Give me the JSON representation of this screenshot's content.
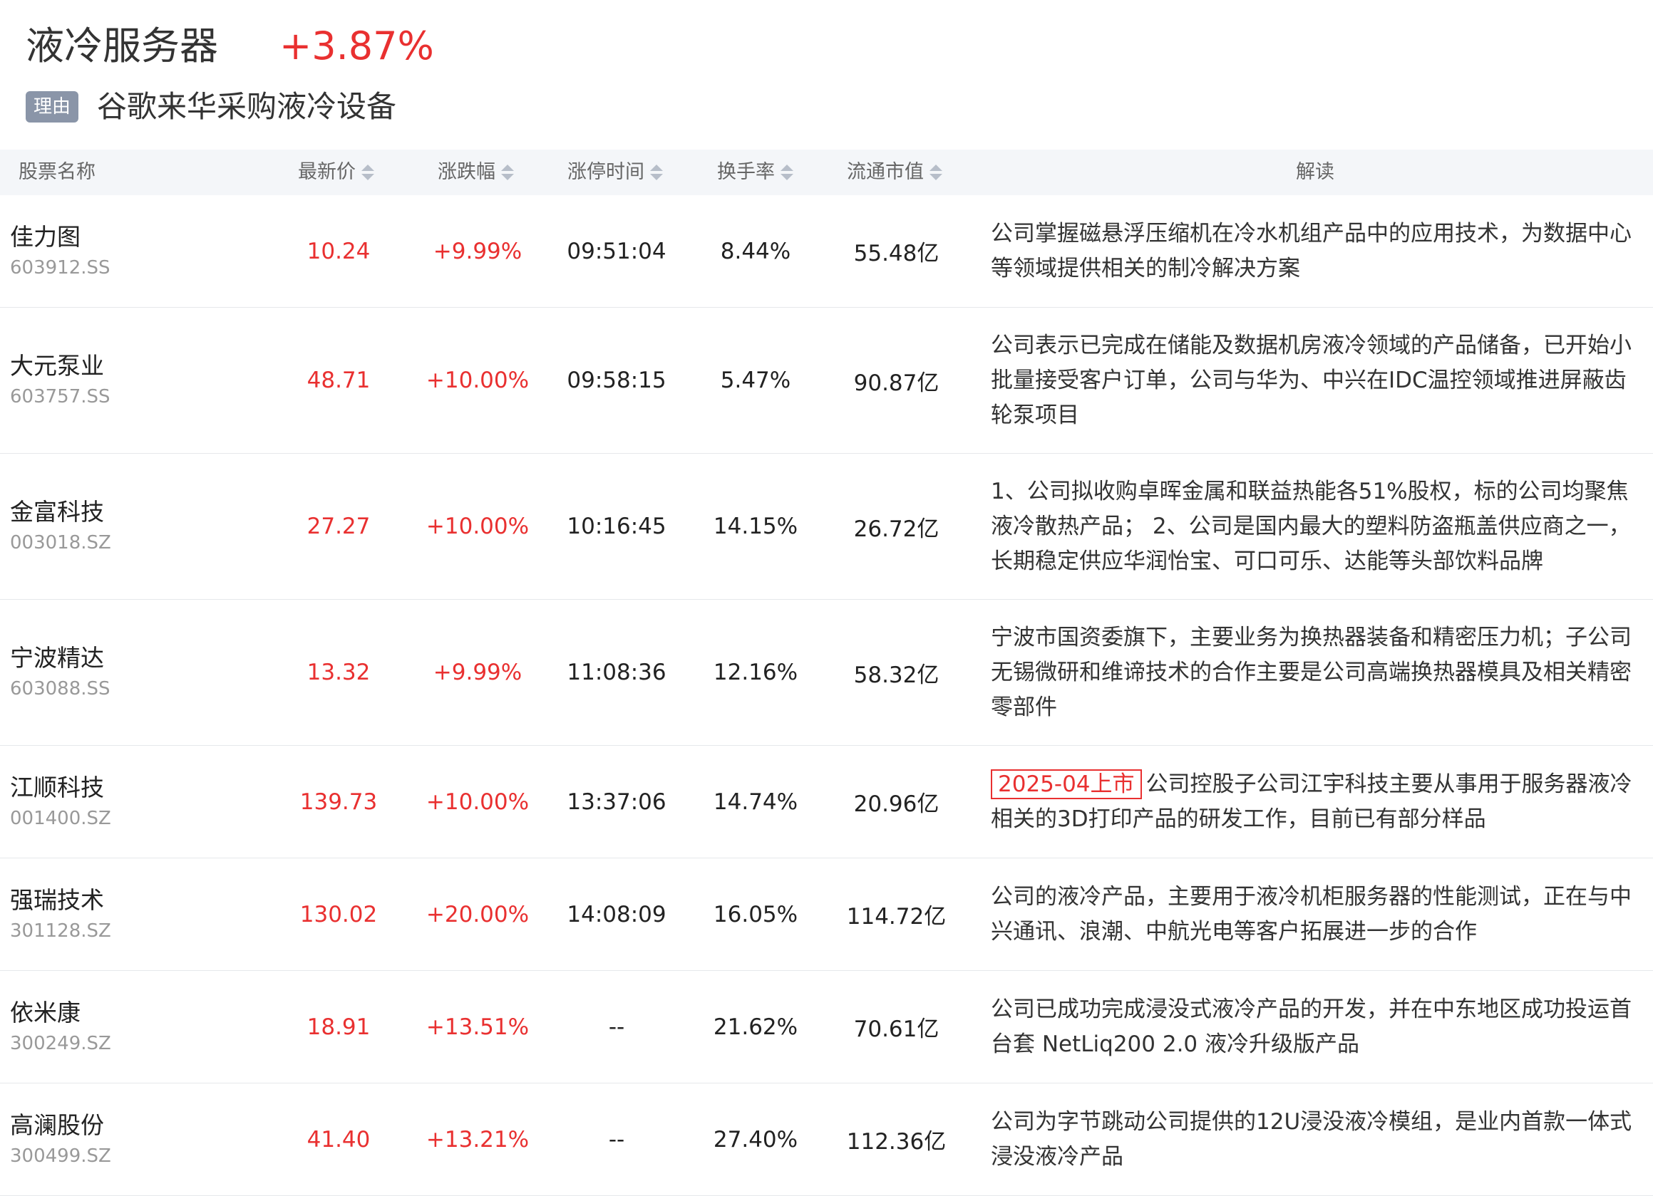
{
  "header": {
    "title": "液冷服务器",
    "change": "+3.87%",
    "reason_tag": "理由",
    "reason_text": "谷歌来华采购液冷设备"
  },
  "columns": {
    "name": "股票名称",
    "price": "最新价",
    "pct": "涨跌幅",
    "limit_time": "涨停时间",
    "turnover": "换手率",
    "mcap": "流通市值",
    "desc": "解读"
  },
  "rows": [
    {
      "name": "佳力图",
      "code": "603912.SS",
      "price": "10.24",
      "pct": "+9.99%",
      "time": "09:51:04",
      "turnover": "8.44%",
      "mcap": "55.48亿",
      "tag": "",
      "desc": "公司掌握磁悬浮压缩机在冷水机组产品中的应用技术，为数据中心等领域提供相关的制冷解决方案"
    },
    {
      "name": "大元泵业",
      "code": "603757.SS",
      "price": "48.71",
      "pct": "+10.00%",
      "time": "09:58:15",
      "turnover": "5.47%",
      "mcap": "90.87亿",
      "tag": "",
      "desc": "公司表示已完成在储能及数据机房液冷领域的产品储备，已开始小批量接受客户订单，公司与华为、中兴在IDC温控领域推进屏蔽齿轮泵项目"
    },
    {
      "name": "金富科技",
      "code": "003018.SZ",
      "price": "27.27",
      "pct": "+10.00%",
      "time": "10:16:45",
      "turnover": "14.15%",
      "mcap": "26.72亿",
      "tag": "",
      "desc": "1、公司拟收购卓晖金属和联益热能各51%股权，标的公司均聚焦液冷散热产品； 2、公司是国内最大的塑料防盗瓶盖供应商之一，长期稳定供应华润怡宝、可口可乐、达能等头部饮料品牌"
    },
    {
      "name": "宁波精达",
      "code": "603088.SS",
      "price": "13.32",
      "pct": "+9.99%",
      "time": "11:08:36",
      "turnover": "12.16%",
      "mcap": "58.32亿",
      "tag": "",
      "desc": "宁波市国资委旗下，主要业务为换热器装备和精密压力机；子公司无锡微研和维谛技术的合作主要是公司高端换热器模具及相关精密零部件"
    },
    {
      "name": "江顺科技",
      "code": "001400.SZ",
      "price": "139.73",
      "pct": "+10.00%",
      "time": "13:37:06",
      "turnover": "14.74%",
      "mcap": "20.96亿",
      "tag": "2025-04上市",
      "desc": "公司控股子公司江宇科技主要从事用于服务器液冷相关的3D打印产品的研发工作，目前已有部分样品"
    },
    {
      "name": "强瑞技术",
      "code": "301128.SZ",
      "price": "130.02",
      "pct": "+20.00%",
      "time": "14:08:09",
      "turnover": "16.05%",
      "mcap": "114.72亿",
      "tag": "",
      "desc": "公司的液冷产品，主要用于液冷机柜服务器的性能测试，正在与中兴通讯、浪潮、中航光电等客户拓展进一步的合作"
    },
    {
      "name": "依米康",
      "code": "300249.SZ",
      "price": "18.91",
      "pct": "+13.51%",
      "time": "--",
      "turnover": "21.62%",
      "mcap": "70.61亿",
      "tag": "",
      "desc": "公司已成功完成浸没式液冷产品的开发，并在中东地区成功投运首台套 NetLiq200 2.0 液冷升级版产品"
    },
    {
      "name": "高澜股份",
      "code": "300499.SZ",
      "price": "41.40",
      "pct": "+13.21%",
      "time": "--",
      "turnover": "27.40%",
      "mcap": "112.36亿",
      "tag": "",
      "desc": "公司为字节跳动公司提供的12U浸没液冷模组，是业内首款一体式浸没液冷产品"
    }
  ]
}
